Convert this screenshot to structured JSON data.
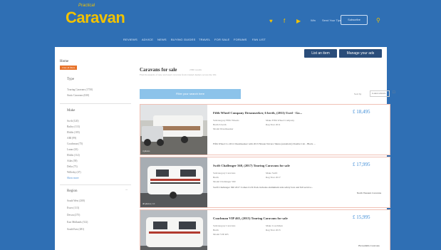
{
  "header": {
    "logo_small": "Practical",
    "logo_big": "Caravan",
    "social": {
      "twitter": "♥",
      "facebook": "f",
      "youtube": "▶"
    },
    "menu": [
      "Win",
      "Send Your Tips"
    ],
    "subscribe_label": "Subscribe"
  },
  "nav": {
    "items": [
      "REVIEWS",
      "ADVICE",
      "NEWS",
      "BUYING GUIDES",
      "TRAVEL",
      "FOR SALE",
      "FORUMS",
      "FAN LIST"
    ]
  },
  "actions": {
    "list_item": "List an item",
    "manage_ads": "Manage your ads"
  },
  "breadcrumb": "Home",
  "filter_badge": "Clear all filters",
  "sidebar": {
    "type_heading": "Type",
    "type_items": [
      "Touring Caravans (1750)",
      "Static Caravans (630)"
    ],
    "make_heading": "Make",
    "make_items": [
      "Swift (120)",
      "Bailey (113)",
      "Elddis (105)",
      "ABI (99)",
      "Coachman (75)",
      "Lunar (43)",
      "Elddis (112)",
      "Atlas (38)",
      "Delta (73)",
      "Willerby (47)"
    ],
    "make_more": "Show more",
    "region_heading": "Region",
    "region_items": [
      "South West (200)",
      "Essex (113)",
      "Devon (275)",
      "East Midlands (312)",
      "South East (281)"
    ]
  },
  "main": {
    "title": "Caravans for sale",
    "title_count": "2380 results",
    "subtitle": "Find thousands of new and used caravans from trusted dealers across the UK",
    "filter_box": "Filter your search here",
    "sort_label": "Sort by",
    "sort_value": "Latest adverts"
  },
  "listings": [
    {
      "title": "Fifth Wheel Company Dreamseeker, 6 berth, (2011) Used - Go...",
      "price": "£ 18,495",
      "photo_caption": "4 photos",
      "meta_left": [
        "Subcategory  Fifth Wheels",
        "Berth  6 berth",
        "Model  Dreamseeker"
      ],
      "meta_right": [
        "Make  Fifth Wheel Company",
        "Reg Year  2011"
      ],
      "desc": "Fifth Wheel Co 2011 Dreamseeker with 2013 Nissan Navara Tekna (automatic) Double Cab - Black ...",
      "dealer": ""
    },
    {
      "title": "Swift Challenger 560, (2017) Touring Caravans for sale",
      "price": "£ 17,995",
      "photo_caption": "40 photos | 1/1",
      "meta_left": [
        "Subcategory  Caravans",
        "Berth",
        "Model  Challenger 560"
      ],
      "meta_right": [
        "Make  Swift",
        "Reg Year  2017"
      ],
      "desc": "Swift Challenger 560 2017 Comes LUX Pack includes aluminium side safety bars and full service...",
      "dealer": "North Western Caravans"
    },
    {
      "title": "Coachman VIP 465, (2015) Touring Caravans for sale",
      "price": "£ 15,995",
      "photo_caption": "",
      "meta_left": [
        "Subcategory  Caravans",
        "Berth",
        "Model  VIP 465"
      ],
      "meta_right": [
        "Make  Coachman",
        "Reg Year  2015"
      ],
      "desc": "",
      "dealer": "Brownhills Caravans"
    }
  ],
  "colors": {
    "brand_blue": "#2f6fb4",
    "logo_yellow": "#f2c200",
    "badge_orange": "#e8732a",
    "price_blue": "#3a8ad6",
    "button_navy": "#2a4d7a"
  }
}
